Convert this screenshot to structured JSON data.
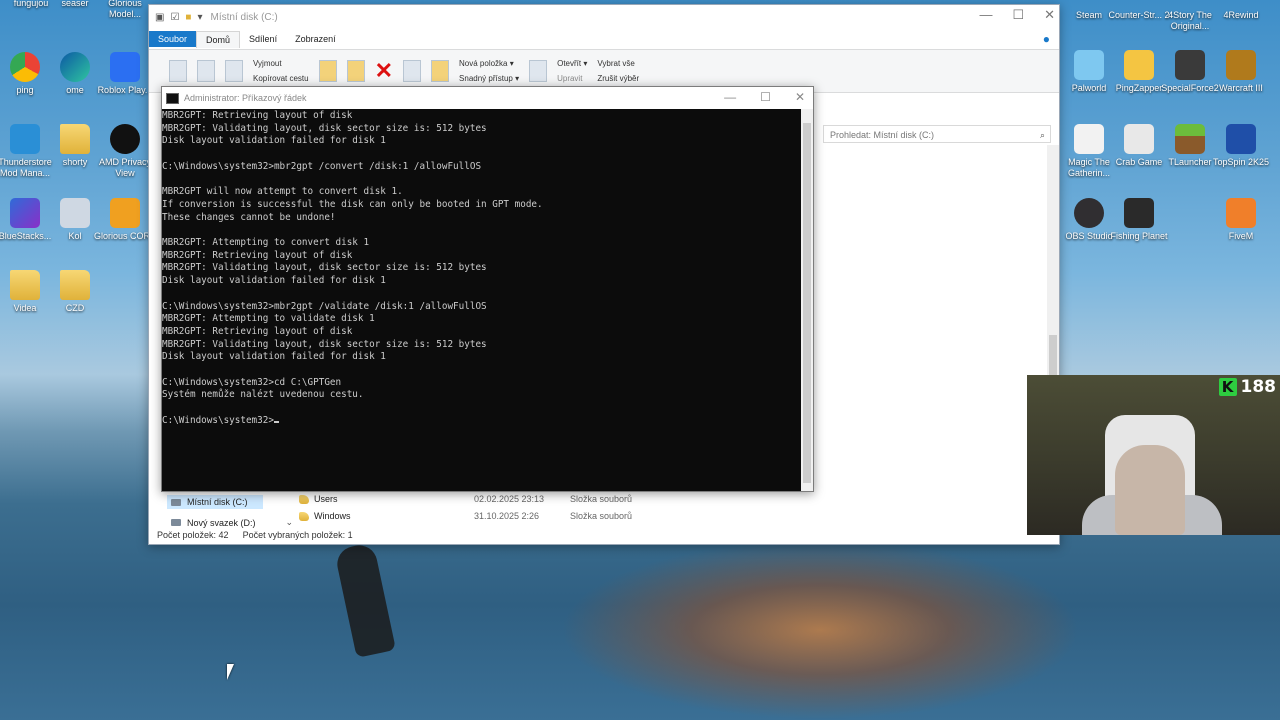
{
  "desktop": {
    "left_icons": [
      {
        "label": "fungujou",
        "color": "#ffffff"
      },
      {
        "label": "seaser",
        "color": "#ffffff"
      },
      {
        "label": "Glorious Model...",
        "color": "#ffffff"
      },
      {
        "label": "ping",
        "color": "#ffffff"
      },
      {
        "label": "ome",
        "color": "#ffffff"
      },
      {
        "label": "Roblox Play...",
        "color": "#ffffff"
      },
      {
        "label": "Thunderstore Mod Mana...",
        "color": "#ffffff"
      },
      {
        "label": "shorty",
        "color": "#ffffff"
      },
      {
        "label": "AMD Privacy View",
        "color": "#ffffff"
      },
      {
        "label": "BlueStacks...",
        "color": "#ffffff"
      },
      {
        "label": "Kol",
        "color": "#ffffff"
      },
      {
        "label": "Glorious CORE",
        "color": "#ffffff"
      },
      {
        "label": "Videa",
        "color": "#ffffff"
      },
      {
        "label": "CZD",
        "color": "#ffffff"
      }
    ],
    "right_icons": [
      {
        "label": "Steam"
      },
      {
        "label": "Counter-Str... 2"
      },
      {
        "label": "4Story The Original..."
      },
      {
        "label": "4Rewind"
      },
      {
        "label": "Palworld"
      },
      {
        "label": "PingZapper"
      },
      {
        "label": "SpecialForce2"
      },
      {
        "label": "Warcraft III"
      },
      {
        "label": "Magic The Gatherin..."
      },
      {
        "label": "Crab Game"
      },
      {
        "label": "TLauncher"
      },
      {
        "label": "TopSpin 2K25"
      },
      {
        "label": "OBS Studio"
      },
      {
        "label": "Fishing Planet"
      },
      {
        "label": "FiveM"
      }
    ]
  },
  "explorer": {
    "title": "Místní disk (C:)",
    "tabs": [
      "Soubor",
      "Domů",
      "Sdílení",
      "Zobrazení"
    ],
    "ribbon": {
      "cut": "Vyjmout",
      "copy_path": "Kopírovat cestu",
      "new_item": "Nová položka ▾",
      "easy_access": "Snadný přístup ▾",
      "open": "Otevřít ▾",
      "edit": "Upravit",
      "select_all": "Vybrat vše",
      "select_none": "Zrušit výběr"
    },
    "search_placeholder": "Prohledat: Místní disk (C:)",
    "nav": [
      {
        "label": "Místní disk (C:)",
        "selected": true
      },
      {
        "label": "Nový svazek (D:)",
        "selected": false
      }
    ],
    "files": [
      {
        "name": "Users",
        "date": "02.02.2025 23:13",
        "type": "Složka souborů"
      },
      {
        "name": "Windows",
        "date": "31.10.2025 2:26",
        "type": "Složka souborů"
      }
    ],
    "status": {
      "items": "Počet položek: 42",
      "selected": "Počet vybraných položek: 1"
    }
  },
  "cmd": {
    "title": "Administrator: Příkazový řádek",
    "lines": [
      "MBR2GPT: Retrieving layout of disk",
      "MBR2GPT: Validating layout, disk sector size is: 512 bytes",
      "Disk layout validation failed for disk 1",
      "",
      "C:\\Windows\\system32>mbr2gpt /convert /disk:1 /allowFullOS",
      "",
      "MBR2GPT will now attempt to convert disk 1.",
      "If conversion is successful the disk can only be booted in GPT mode.",
      "These changes cannot be undone!",
      "",
      "MBR2GPT: Attempting to convert disk 1",
      "MBR2GPT: Retrieving layout of disk",
      "MBR2GPT: Validating layout, disk sector size is: 512 bytes",
      "Disk layout validation failed for disk 1",
      "",
      "C:\\Windows\\system32>mbr2gpt /validate /disk:1 /allowFullOS",
      "MBR2GPT: Attempting to validate disk 1",
      "MBR2GPT: Retrieving layout of disk",
      "MBR2GPT: Validating layout, disk sector size is: 512 bytes",
      "Disk layout validation failed for disk 1",
      "",
      "C:\\Windows\\system32>cd C:\\GPTGen",
      "Systém nemůže nalézt uvedenou cestu.",
      "",
      "C:\\Windows\\system32>"
    ]
  },
  "webcam": {
    "viewer_count": "188",
    "platform_letter": "K",
    "accent": "#2ecc40"
  }
}
